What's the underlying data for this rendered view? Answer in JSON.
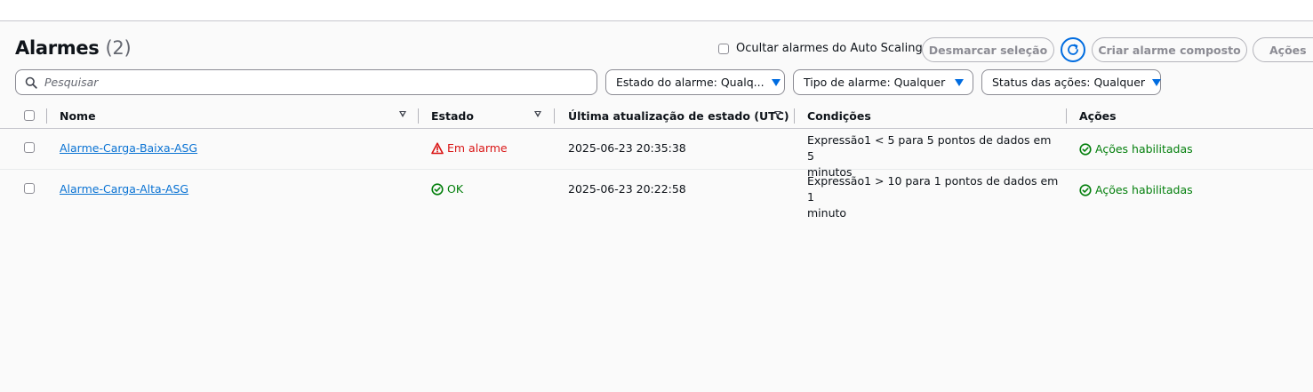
{
  "header": {
    "title": "Alarmes",
    "count": "(2)"
  },
  "toolbar": {
    "hide_asg_label": "Ocultar alarmes do Auto Scaling",
    "deselect_label": "Desmarcar seleção",
    "create_composite_label": "Criar alarme composto",
    "actions_label": "Ações"
  },
  "filters": {
    "search_placeholder": "Pesquisar",
    "alarm_state": "Estado do alarme: Qualq...",
    "alarm_type": "Tipo de alarme: Qualquer",
    "actions_status": "Status das ações: Qualquer"
  },
  "table": {
    "columns": [
      "Nome",
      "Estado",
      "Última atualização de estado (UTC)",
      "Condições",
      "Ações"
    ],
    "rows": [
      {
        "name": "Alarme-Carga-Baixa-ASG",
        "state": "Em alarme",
        "state_icon": "warning-icon",
        "updated": "2025-06-23 20:35:38",
        "condition_line1": "Expressão1 < 5 para 5 pontos de dados em 5",
        "condition_line2": "minutos",
        "actions": "Ações habilitadas"
      },
      {
        "name": "Alarme-Carga-Alta-ASG",
        "state": "OK",
        "state_icon": "check-circle-icon",
        "updated": "2025-06-23 20:22:58",
        "condition_line1": "Expressão1 > 10 para 1 pontos de dados em 1",
        "condition_line2": "minuto",
        "actions": "Ações habilitadas"
      }
    ]
  },
  "colors": {
    "alarm": "#d91515",
    "ok": "#037f0c",
    "link": "#0972d3",
    "accent": "#006ce0"
  }
}
